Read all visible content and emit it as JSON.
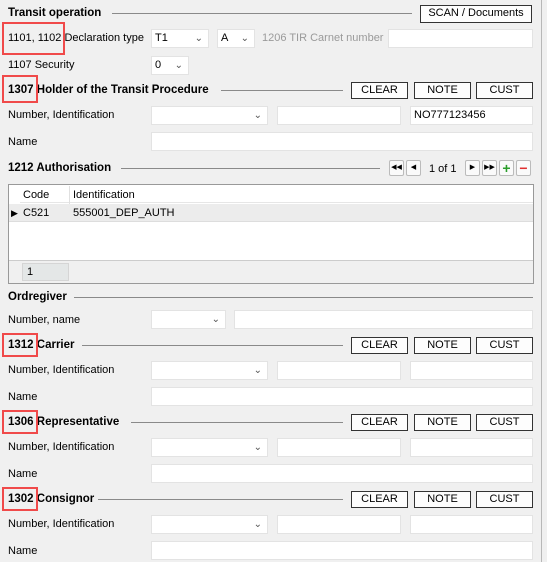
{
  "transit": {
    "title": "Transit operation",
    "scan_button": "SCAN / Documents",
    "decl_label": "1101, 1102 Declaration type",
    "decl_type": "T1",
    "decl_sub": "A",
    "tir_label": "1206 TIR Carnet number",
    "tir_value": "",
    "security_label": "1107 Security",
    "security_value": "0"
  },
  "buttons": {
    "clear": "CLEAR",
    "note": "NOTE",
    "cust": "CUST"
  },
  "labels": {
    "number_id": "Number, Identification",
    "name": "Name",
    "number_name": "Number, name"
  },
  "holder": {
    "title": "1307 Holder of the Transit Procedure",
    "id_value": "NO777123456"
  },
  "authorisation": {
    "title": "1212 Authorisation",
    "pager": "1 of 1",
    "columns": [
      "Code",
      "Identification"
    ],
    "rows": [
      {
        "code": "C521",
        "identification": "555001_DEP_AUTH"
      }
    ],
    "footer_count": "1"
  },
  "ordregiver": {
    "title": "Ordregiver"
  },
  "carrier": {
    "title": "1312 Carrier"
  },
  "representative": {
    "title": "1306 Representative"
  },
  "consignor": {
    "title": "1302 Consignor"
  },
  "colors": {
    "highlight": "#f04a4a",
    "add": "#2a9d2a",
    "remove": "#e03030"
  }
}
